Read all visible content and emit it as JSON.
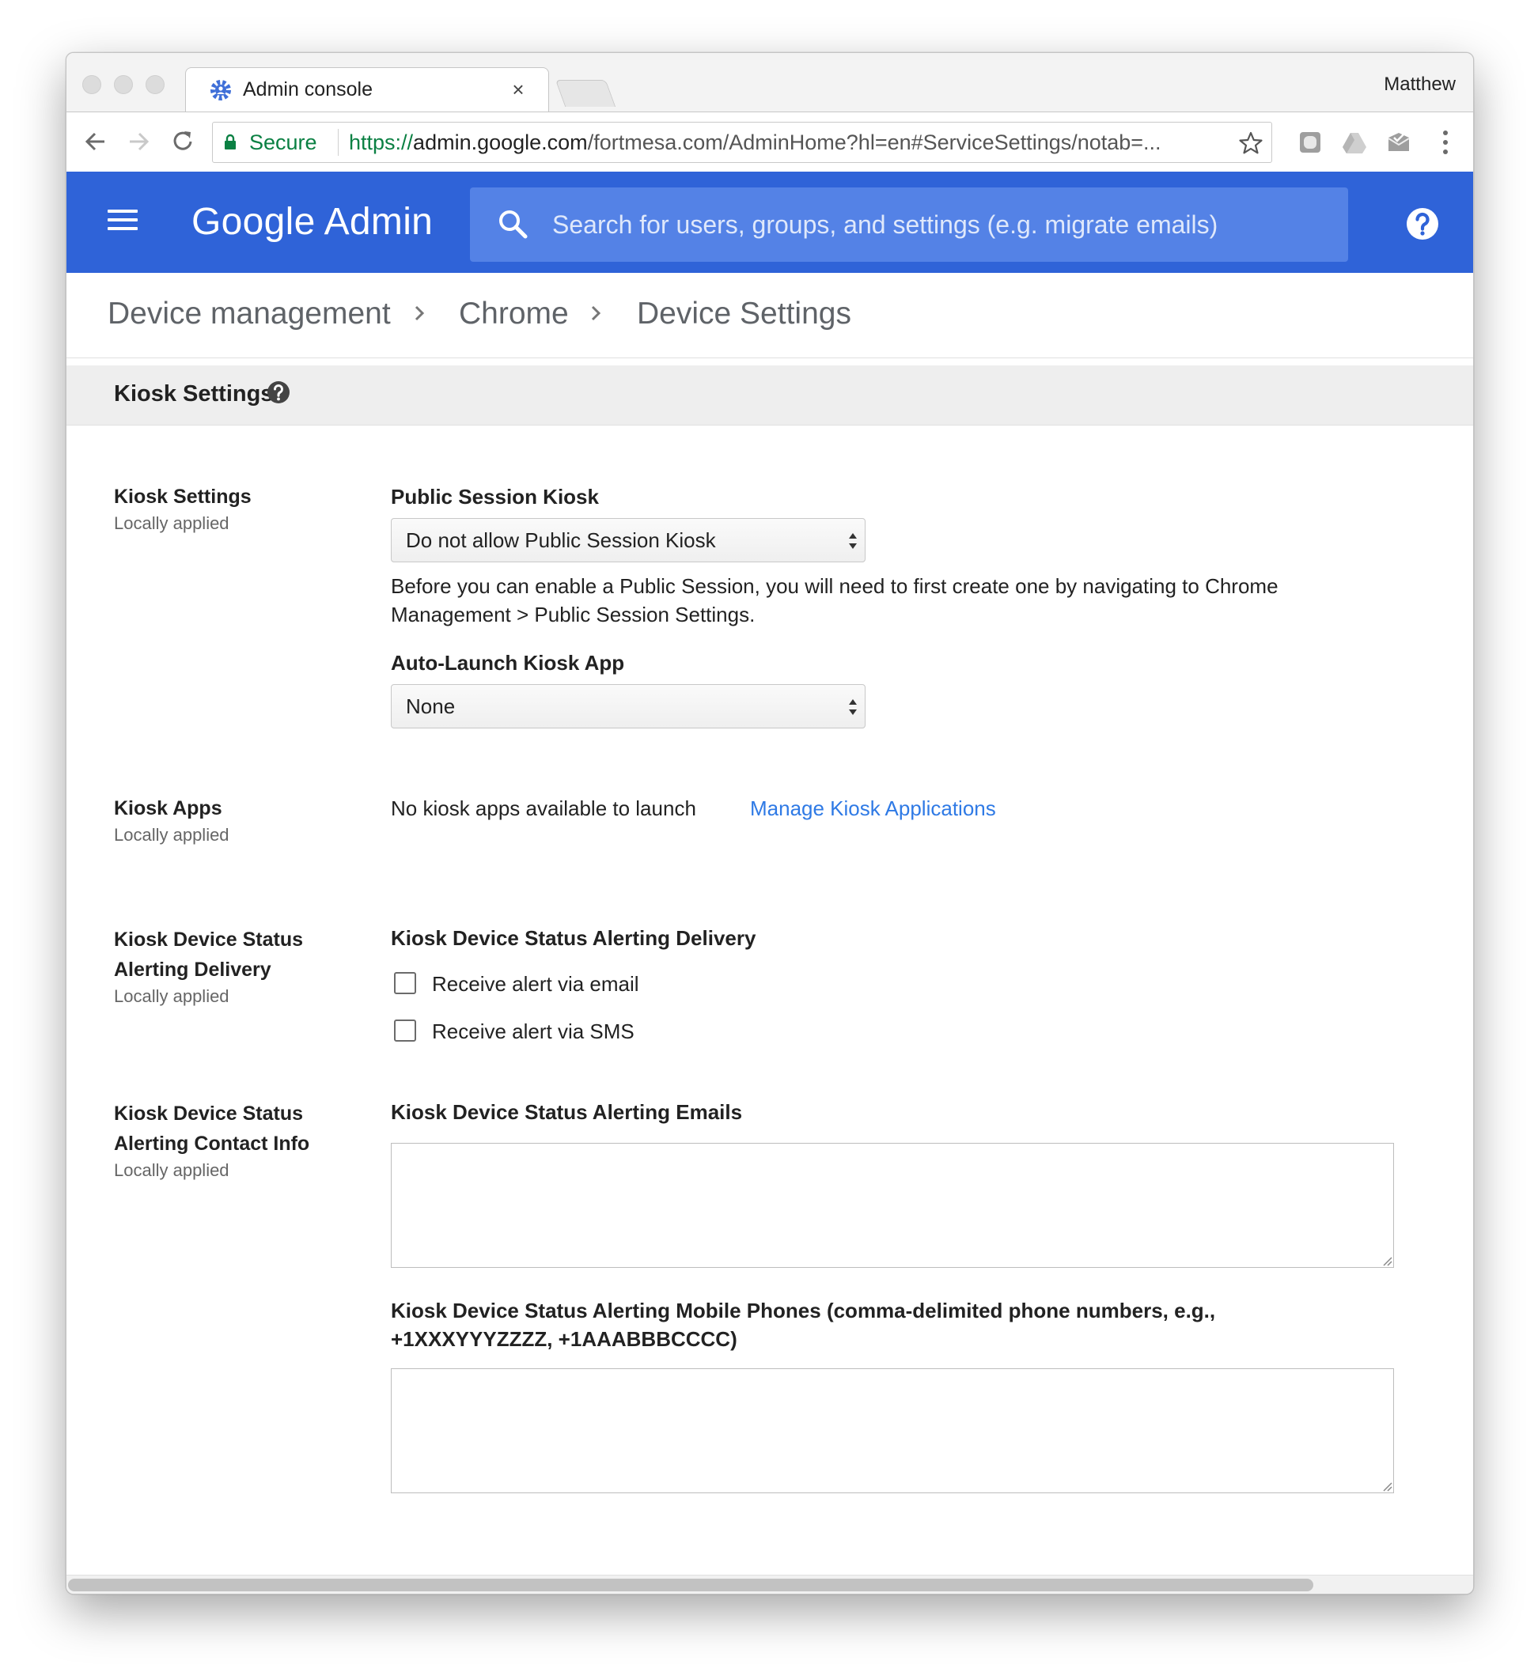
{
  "browser": {
    "tab_title": "Admin console",
    "tab_close": "×",
    "profile_name": "Matthew",
    "secure_label": "Secure",
    "url_scheme": "https://",
    "url_host": "admin.google.com",
    "url_path": "/fortmesa.com/AdminHome?hl=en#ServiceSettings/notab=..."
  },
  "header": {
    "brand_google": "Google",
    "brand_admin": "Admin",
    "search_placeholder": "Search for users, groups, and settings (e.g. migrate emails)",
    "accent_color": "#2f63d8"
  },
  "breadcrumb": {
    "items": [
      "Device management",
      "Chrome",
      "Device Settings"
    ]
  },
  "section": {
    "title": "Kiosk Settings"
  },
  "settings": {
    "kiosk_settings": {
      "title": "Kiosk Settings",
      "sub": "Locally applied",
      "public_session_label": "Public Session Kiosk",
      "public_session_value": "Do not allow Public Session Kiosk",
      "note": "Before you can enable a Public Session, you will need to first create one by navigating to Chrome Management > Public Session Settings.",
      "auto_launch_label": "Auto-Launch Kiosk App",
      "auto_launch_value": "None"
    },
    "kiosk_apps": {
      "title": "Kiosk Apps",
      "sub": "Locally applied",
      "status": "No kiosk apps available to launch",
      "manage_link": "Manage Kiosk Applications"
    },
    "alert_delivery": {
      "title_line1": "Kiosk Device Status",
      "title_line2": "Alerting Delivery",
      "sub": "Locally applied",
      "field_label": "Kiosk Device Status Alerting Delivery",
      "email_option": "Receive alert via email",
      "sms_option": "Receive alert via SMS"
    },
    "alert_contact": {
      "title_line1": "Kiosk Device Status",
      "title_line2": "Alerting Contact Info",
      "sub": "Locally applied",
      "emails_label": "Kiosk Device Status Alerting Emails",
      "emails_value": "",
      "phones_label": "Kiosk Device Status Alerting Mobile Phones (comma-delimited phone numbers, e.g., +1XXXYYYZZZZ, +1AAABBBCCCC)",
      "phones_value": ""
    }
  }
}
